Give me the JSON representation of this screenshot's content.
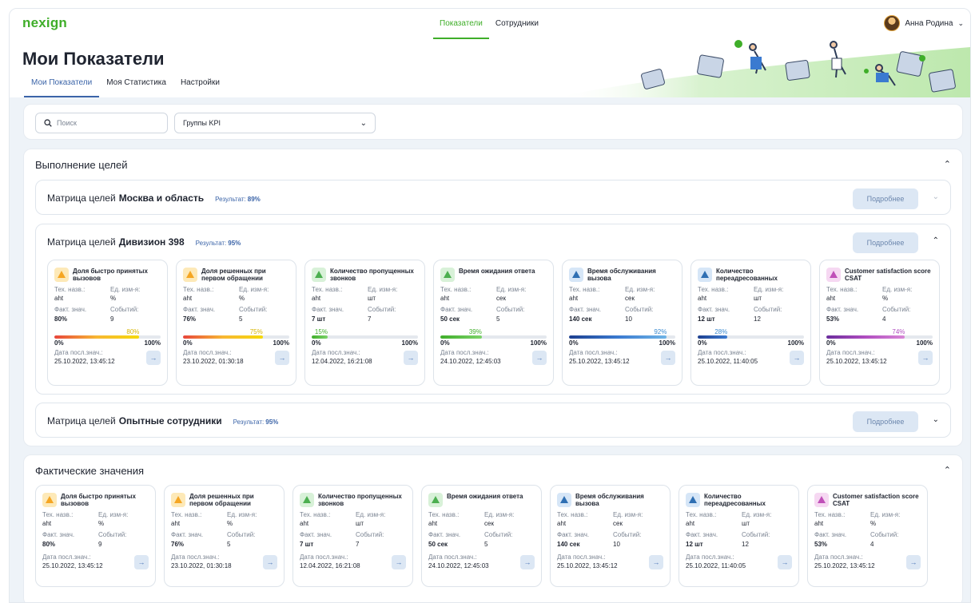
{
  "app": {
    "logo": "nexign"
  },
  "nav": {
    "items": [
      "Показатели",
      "Сотрудники"
    ],
    "active": 0
  },
  "user": {
    "name": "Анна Родина"
  },
  "header": {
    "title": "Мои Показатели",
    "tabs": [
      "Мои Показатели",
      "Моя Статистика",
      "Настройки"
    ],
    "active_tab": 0
  },
  "filters": {
    "search_placeholder": "Поиск",
    "group_select": "Группы KPI"
  },
  "goals": {
    "title": "Выполнение целей",
    "matrices": [
      {
        "prefix": "Матрица целей",
        "name": "Москва и область",
        "result_label": "Результат:",
        "result": "89%",
        "more": "Подробнее",
        "expanded": false
      },
      {
        "prefix": "Матрица целей",
        "name": "Дивизион 398",
        "result_label": "Результат:",
        "result": "95%",
        "more": "Подробнее",
        "expanded": true
      },
      {
        "prefix": "Матрица целей",
        "name": "Опытные сотрудники",
        "result_label": "Результат:",
        "result": "95%",
        "more": "Подробнее",
        "expanded": false
      }
    ]
  },
  "facts": {
    "title": "Фактические значения"
  },
  "labels": {
    "tech": "Тех. назв.:",
    "unit": "Ед. изм-я:",
    "fact": "Факт. знач.",
    "events": "Событий:",
    "date": "Дата посл.знач.:",
    "min": "0%",
    "max": "100%"
  },
  "kpis": [
    {
      "name": "Доля быстро принятых вызовов",
      "tech": "aht",
      "unit": "%",
      "fact": "80%",
      "events": "9",
      "progress_label": "80%",
      "progress": 80,
      "date": "25.10.2022, 13:45:12",
      "color": "#f5a623",
      "icon_bg": "#fde9b8",
      "fill": "linear-gradient(90deg,#e8453c,#f7b733,#f5d90a)",
      "pct_color": "#d6b400"
    },
    {
      "name": "Доля решенных при первом обращении",
      "tech": "aht",
      "unit": "%",
      "fact": "76%",
      "events": "5",
      "progress_label": "75%",
      "progress": 75,
      "date": "23.10.2022, 01:30:18",
      "color": "#f5a623",
      "icon_bg": "#fde9b8",
      "fill": "linear-gradient(90deg,#e8453c,#f7b733,#f5d90a)",
      "pct_color": "#d6b400"
    },
    {
      "name": "Количество пропущенных звонков",
      "tech": "aht",
      "unit": "шт",
      "fact": "7 шт",
      "events": "7",
      "progress_label": "15%",
      "progress": 15,
      "date": "12.04.2022, 16:21:08",
      "color": "#4caf50",
      "icon_bg": "#d8f1d8",
      "fill": "linear-gradient(90deg,#3fae29,#7dd36b)",
      "pct_color": "#3fae29"
    },
    {
      "name": "Время ожидания ответа",
      "tech": "aht",
      "unit": "сек",
      "fact": "50 сек",
      "events": "5",
      "progress_label": "39%",
      "progress": 39,
      "date": "24.10.2022, 12:45:03",
      "color": "#4caf50",
      "icon_bg": "#d8f1d8",
      "fill": "linear-gradient(90deg,#3fae29,#7dd36b)",
      "pct_color": "#3fae29"
    },
    {
      "name": "Время обслуживания вызова",
      "tech": "aht",
      "unit": "сек",
      "fact": "140 сек",
      "events": "10",
      "progress_label": "92%",
      "progress": 92,
      "date": "25.10.2022, 13:45:12",
      "color": "#2f6fb3",
      "icon_bg": "#d6e6f7",
      "fill": "linear-gradient(90deg,#1d3f8f,#3a7ad0,#6fb4e6)",
      "pct_color": "#3a8ad0"
    },
    {
      "name": "Количество переадресованных",
      "tech": "aht",
      "unit": "шт",
      "fact": "12 шт",
      "events": "12",
      "progress_label": "28%",
      "progress": 28,
      "date": "25.10.2022, 11:40:05",
      "color": "#2f6fb3",
      "icon_bg": "#d6e6f7",
      "fill": "linear-gradient(90deg,#1d3f8f,#3a7ad0)",
      "pct_color": "#3a8ad0"
    },
    {
      "name": "Customer satisfaction score CSAT",
      "tech": "aht",
      "unit": "%",
      "fact": "53%",
      "events": "4",
      "progress_label": "74%",
      "progress": 74,
      "date": "25.10.2022, 13:45:12",
      "color": "#c04fb8",
      "icon_bg": "#f6d8f2",
      "fill": "linear-gradient(90deg,#6b2d9c,#b04dc0,#d887d6)",
      "pct_color": "#b04dc0"
    }
  ]
}
